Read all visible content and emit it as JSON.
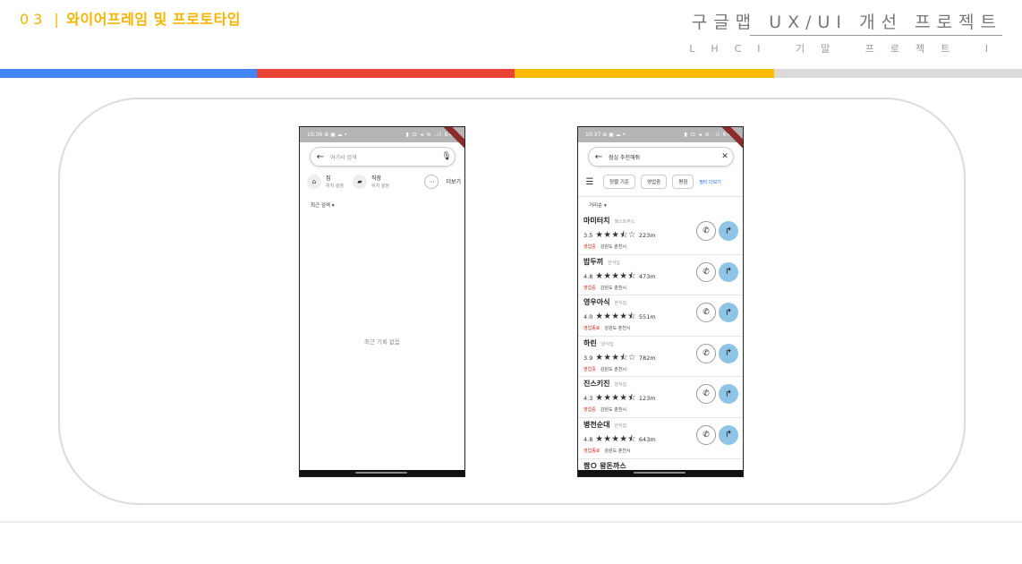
{
  "header": {
    "section_number": "03",
    "separator": "|",
    "section_title": "와이어프레임 및 프로토타입",
    "project_title": "구글맵 UX/UI 개선 프로젝트",
    "project_subtitle": "LHCI 기말 프로젝트 I"
  },
  "color_bar": [
    "#4285f4",
    "#ea4335",
    "#fbbc05",
    "#dadada"
  ],
  "phone1": {
    "status_time": "10:36",
    "status_icons": "⊕ ▣ ☁ •",
    "status_right": "▮ ⊡ ◂ ≋ .ıl 64%",
    "search": {
      "back_icon": "arrow-left-icon",
      "placeholder": "여기서 검색",
      "mic_icon": "mic-icon"
    },
    "shortcuts": [
      {
        "icon": "home-icon",
        "label": "집",
        "sub": "위치 설정"
      },
      {
        "icon": "briefcase-icon",
        "label": "직장",
        "sub": "위치 설정"
      }
    ],
    "more_label": "더보기",
    "recent_header": "최근 검색",
    "empty_message": "최근 기록 없음"
  },
  "phone2": {
    "status_time": "10:37",
    "status_icons": "⊕ ▣ ☁ •",
    "status_right": "▮ ⊡ ◂ ≋ .ıl 64%",
    "search": {
      "back_icon": "arrow-left-icon",
      "query": "점심 추천해줘",
      "clear_icon": "close-icon"
    },
    "filters": [
      "정렬 기준",
      "영업중",
      "평점"
    ],
    "more_filters": "필터 더보기",
    "sort_label": "거리순",
    "results": [
      {
        "name": "마미터치",
        "category": "패스트푸드",
        "rating": "3.5",
        "stars": "★★★⯪☆",
        "distance": "223m",
        "status": "영업중",
        "address": "강원도 춘천시"
      },
      {
        "name": "밥두끼",
        "category": "한식집",
        "rating": "4.8",
        "stars": "★★★★⯪",
        "distance": "473m",
        "status": "영업중",
        "address": "강원도 춘천시"
      },
      {
        "name": "영우아식",
        "category": "한식집",
        "rating": "4.0",
        "stars": "★★★★⯪",
        "distance": "551m",
        "status": "영업종료",
        "address": "강원도 춘천시"
      },
      {
        "name": "하린",
        "category": "양식집",
        "rating": "3.9",
        "stars": "★★★⯪☆",
        "distance": "782m",
        "status": "영업중",
        "address": "강원도 춘천시"
      },
      {
        "name": "진스키진",
        "category": "양식집",
        "rating": "4.3",
        "stars": "★★★★⯪",
        "distance": "123m",
        "status": "영업중",
        "address": "강원도 춘천시"
      },
      {
        "name": "병천순대",
        "category": "한식집",
        "rating": "4.8",
        "stars": "★★★★⯪",
        "distance": "643m",
        "status": "영업종료",
        "address": "강원도 춘천시"
      }
    ],
    "peek_item": "짬Ｏ 왕돈까스",
    "call_icon": "phone-icon",
    "directions_icon": "directions-icon"
  }
}
